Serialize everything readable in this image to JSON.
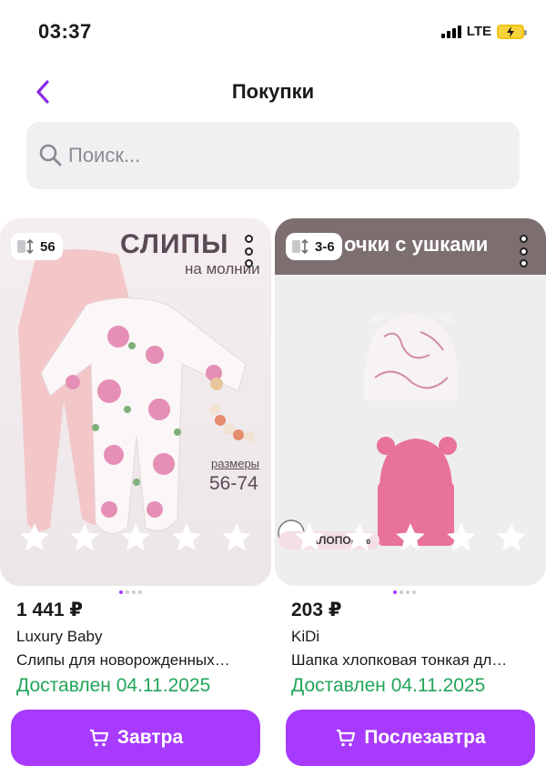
{
  "status_bar": {
    "time": "03:37",
    "network": "LTE"
  },
  "header": {
    "title": "Покупки",
    "back_icon": "chevron-left-icon"
  },
  "search": {
    "placeholder": "Поиск...",
    "value": ""
  },
  "products": [
    {
      "size_badge": "56",
      "image_title": "СЛИПЫ",
      "image_subtitle": "на молнии",
      "image_size_label": "размеры",
      "image_size_range": "56-74",
      "price": "1 441 ₽",
      "brand": "Luxury Baby",
      "title": "Слипы для новорожденных…",
      "delivery_status": "Доставлен 04.11.2025",
      "button_label": "Завтра",
      "rating_stars": 5,
      "gallery_pages": 4,
      "gallery_active": 1
    },
    {
      "size_badge": "3-6",
      "image_title": "очки с ушками",
      "image_badge": "ХЛОПОК\n%",
      "price": "203 ₽",
      "brand": "KiDi",
      "title": "Шапка хлопковая тонкая дл…",
      "delivery_status": "Доставлен 04.11.2025",
      "button_label": "Послезавтра",
      "rating_stars": 5,
      "gallery_pages": 4,
      "gallery_active": 1
    }
  ],
  "colors": {
    "accent": "#a73afd",
    "delivered": "#22a55a",
    "search_bg": "#f0f0f2"
  }
}
